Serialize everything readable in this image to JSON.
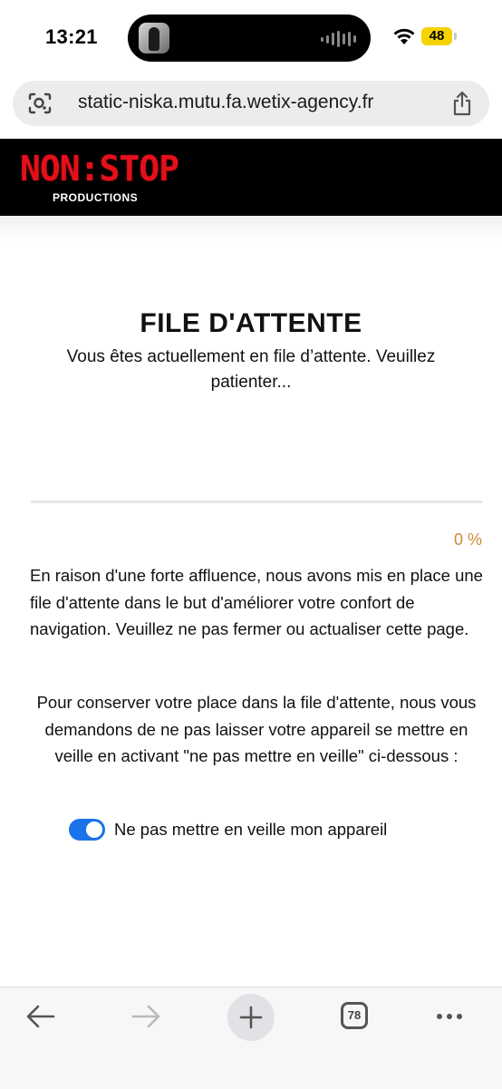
{
  "status_bar": {
    "time": "13:21",
    "battery": "48"
  },
  "browser": {
    "url": "static-niska.mutu.fa.wetix-agency.fr",
    "tab_count": "78",
    "icons": [
      "lens-icon",
      "share-icon",
      "back-arrow-icon",
      "forward-arrow-icon",
      "plus-icon",
      "tabs-icon",
      "more-icon"
    ]
  },
  "header": {
    "logo_main": "NON:STOP",
    "logo_sub": "PRODUCTIONS"
  },
  "queue": {
    "title": "FILE D'ATTENTE",
    "subtitle": "Vous êtes actuellement en file d’attente. Veuillez patienter...",
    "progress_percent": 0,
    "progress_label": "0 %",
    "paragraph1": "En raison d'une forte affluence, nous avons mis en place une file d'attente dans le but d'améliorer votre confort de navigation. Veuillez ne pas fermer ou actualiser cette page.",
    "paragraph2": "Pour conserver votre place dans la file d'attente, nous vous demandons de ne pas laisser votre appareil se mettre en veille en activant \"ne pas mettre en veille\" ci-dessous :",
    "toggle_label": "Ne pas mettre en veille mon appareil",
    "toggle_on": true
  },
  "colors": {
    "accent": "#1a73e8",
    "progress": "#d08a35",
    "logo_red": "#e3101c",
    "battery": "#f4d300"
  }
}
